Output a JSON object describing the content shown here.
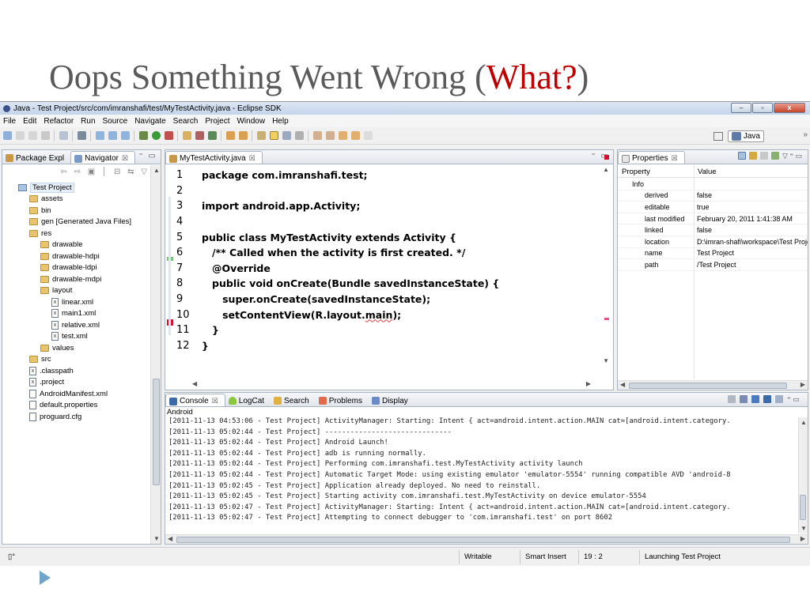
{
  "slide": {
    "title_prefix": "Oops Something Went Wrong (",
    "title_highlight": "What?",
    "title_suffix": ")",
    "highlight_color": "#c00000"
  },
  "window": {
    "title": "Java - Test Project/src/com/imranshafi/test/MyTestActivity.java - Eclipse SDK",
    "close_label": "x",
    "minimize_label": "–",
    "restore_label": "▫"
  },
  "menu": [
    "File",
    "Edit",
    "Refactor",
    "Run",
    "Source",
    "Navigate",
    "Search",
    "Project",
    "Window",
    "Help"
  ],
  "perspective": {
    "label": "Java",
    "overflow": "»"
  },
  "navigator": {
    "tabs": [
      {
        "label": "Package Expl",
        "icon": "package-icon"
      },
      {
        "label": "Navigator",
        "icon": "navigator-icon",
        "close": "☒"
      }
    ],
    "tools": "⇦ ⇨ ▣ │ ⊟ ⇆ ▽",
    "minmax": "⁼ ▭",
    "tree": [
      {
        "label": "Test Project",
        "level": 0,
        "icon": "project",
        "selected": true
      },
      {
        "label": "assets",
        "level": 1,
        "icon": "folder"
      },
      {
        "label": "bin",
        "level": 1,
        "icon": "folder"
      },
      {
        "label": "gen [Generated Java Files]",
        "level": 1,
        "icon": "folder"
      },
      {
        "label": "res",
        "level": 1,
        "icon": "folder"
      },
      {
        "label": "drawable",
        "level": 2,
        "icon": "folder"
      },
      {
        "label": "drawable-hdpi",
        "level": 2,
        "icon": "folder"
      },
      {
        "label": "drawable-ldpi",
        "level": 2,
        "icon": "folder"
      },
      {
        "label": "drawable-mdpi",
        "level": 2,
        "icon": "folder"
      },
      {
        "label": "layout",
        "level": 2,
        "icon": "folder"
      },
      {
        "label": "linear.xml",
        "level": 3,
        "icon": "xml"
      },
      {
        "label": "main1.xml",
        "level": 3,
        "icon": "xml"
      },
      {
        "label": "relative.xml",
        "level": 3,
        "icon": "xml"
      },
      {
        "label": "test.xml",
        "level": 3,
        "icon": "xml"
      },
      {
        "label": "values",
        "level": 2,
        "icon": "folder"
      },
      {
        "label": "src",
        "level": 1,
        "icon": "folder"
      },
      {
        "label": ".classpath",
        "level": 1,
        "icon": "xml"
      },
      {
        "label": ".project",
        "level": 1,
        "icon": "xml"
      },
      {
        "label": "AndroidManifest.xml",
        "level": 1,
        "icon": "file"
      },
      {
        "label": "default.properties",
        "level": 1,
        "icon": "file"
      },
      {
        "label": "proguard.cfg",
        "level": 1,
        "icon": "file"
      }
    ]
  },
  "editor": {
    "tab": {
      "label": "MyTestActivity.java",
      "close": "☒"
    },
    "minmax": "⁼ ▭",
    "lines": [
      {
        "n": "1",
        "text": "package com.imranshafi.test;"
      },
      {
        "n": "2",
        "text": ""
      },
      {
        "n": "3",
        "text": "import android.app.Activity;"
      },
      {
        "n": "4",
        "text": ""
      },
      {
        "n": "5",
        "text": "public class MyTestActivity extends Activity {"
      },
      {
        "n": "6",
        "text": "   /** Called when the activity is first created. */"
      },
      {
        "n": "7",
        "text": "   @Override"
      },
      {
        "n": "8",
        "text": "   public void onCreate(Bundle savedInstanceState) {"
      },
      {
        "n": "9",
        "text": "      super.onCreate(savedInstanceState);"
      },
      {
        "n": "10",
        "text_before": "      setContentView(R.layout.",
        "text_error": "main",
        "text_after": ");"
      },
      {
        "n": "11",
        "text": "   }"
      },
      {
        "n": "12",
        "text": "}"
      }
    ]
  },
  "properties": {
    "tab": {
      "label": "Properties",
      "close": "☒"
    },
    "columns": [
      "Property",
      "Value"
    ],
    "rows": [
      {
        "key": "Info",
        "value": "",
        "category": true
      },
      {
        "key": "derived",
        "value": "false"
      },
      {
        "key": "editable",
        "value": "true"
      },
      {
        "key": "last modified",
        "value": "February 20, 2011 1:41:38 AM"
      },
      {
        "key": "linked",
        "value": "false"
      },
      {
        "key": "location",
        "value": "D:\\imran-shafi\\workspace\\Test Project"
      },
      {
        "key": "name",
        "value": "Test Project"
      },
      {
        "key": "path",
        "value": "/Test Project"
      }
    ]
  },
  "console": {
    "tabs": [
      {
        "label": "Console",
        "close": "☒",
        "icon": "console-icon"
      },
      {
        "label": "LogCat",
        "icon": "android-icon"
      },
      {
        "label": "Search",
        "icon": "search-icon"
      },
      {
        "label": "Problems",
        "icon": "problems-icon"
      },
      {
        "label": "Display",
        "icon": "display-icon"
      }
    ],
    "subtitle": "Android",
    "lines": [
      "[2011-11-13 04:53:06 - Test Project] ActivityManager: Starting: Intent { act=android.intent.action.MAIN cat=[android.intent.category.",
      "[2011-11-13 05:02:44 - Test Project] ------------------------------",
      "[2011-11-13 05:02:44 - Test Project] Android Launch!",
      "[2011-11-13 05:02:44 - Test Project] adb is running normally.",
      "[2011-11-13 05:02:44 - Test Project] Performing com.imranshafi.test.MyTestActivity activity launch",
      "[2011-11-13 05:02:44 - Test Project] Automatic Target Mode: using existing emulator 'emulator-5554' running compatible AVD 'android-8",
      "[2011-11-13 05:02:45 - Test Project] Application already deployed. No need to reinstall.",
      "[2011-11-13 05:02:45 - Test Project] Starting activity com.imranshafi.test.MyTestActivity on device emulator-5554",
      "[2011-11-13 05:02:47 - Test Project] ActivityManager: Starting: Intent { act=android.intent.action.MAIN cat=[android.intent.category.",
      "[2011-11-13 05:02:47 - Test Project] Attempting to connect debugger to 'com.imranshafi.test' on port 8602"
    ]
  },
  "statusbar": {
    "left": "▯°",
    "writable": "Writable",
    "insert_mode": "Smart Insert",
    "position": "19 : 2",
    "progress": "Launching Test Project"
  },
  "colors": {
    "error_marker": "#d01030",
    "accent": "#4a72b0"
  }
}
